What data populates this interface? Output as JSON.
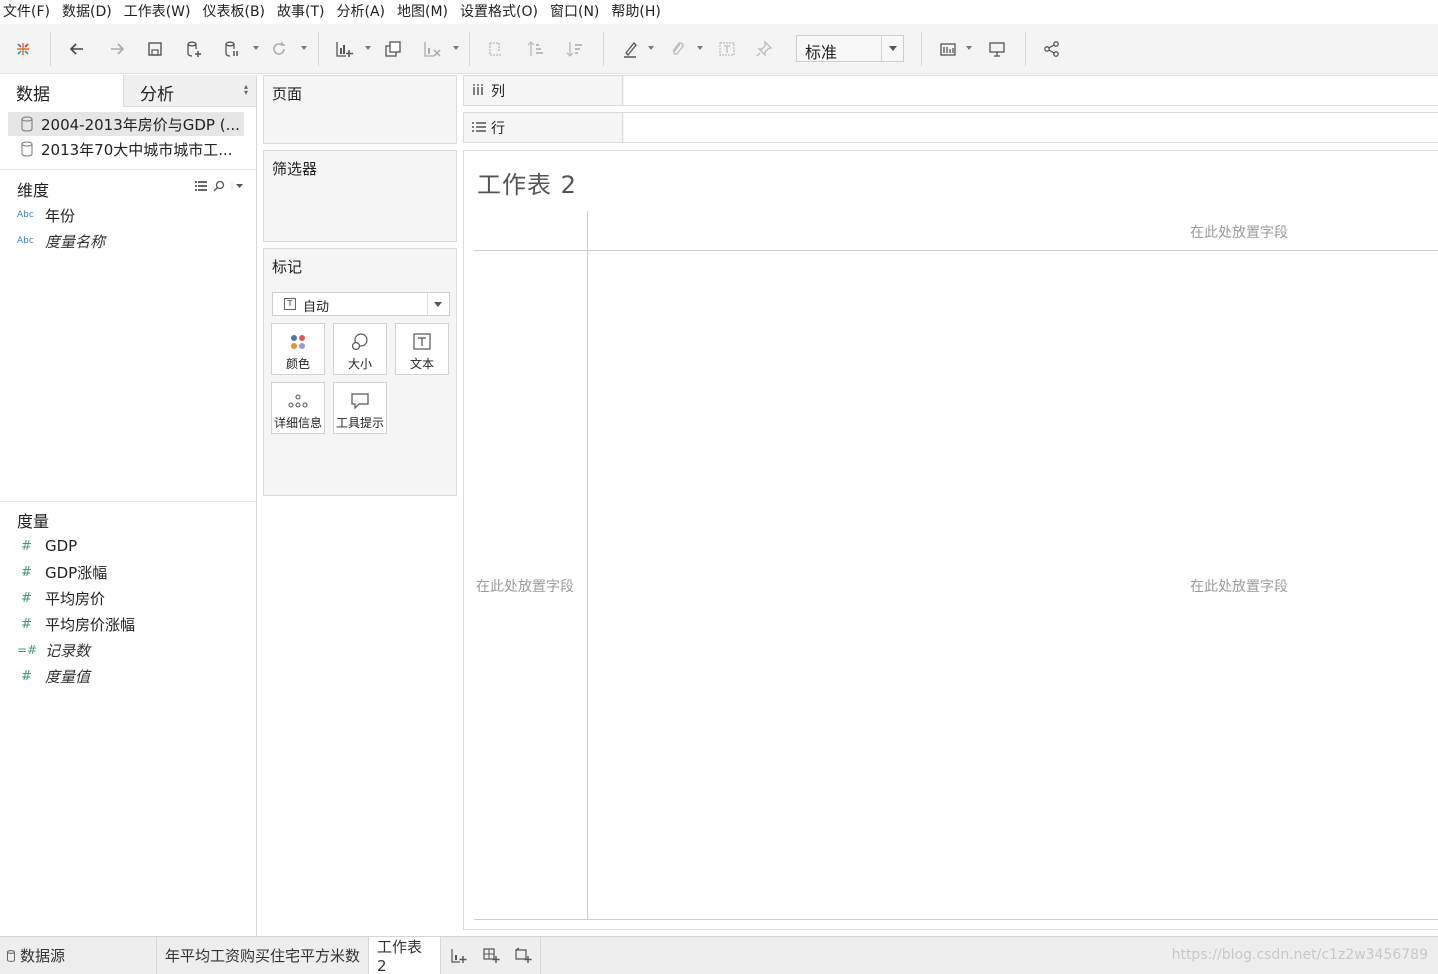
{
  "menu": [
    "文件(F)",
    "数据(D)",
    "工作表(W)",
    "仪表板(B)",
    "故事(T)",
    "分析(A)",
    "地图(M)",
    "设置格式(O)",
    "窗口(N)",
    "帮助(H)"
  ],
  "toolbar": {
    "fit_value": "标准"
  },
  "data_pane": {
    "tab_data": "数据",
    "tab_analysis": "分析",
    "datasources": [
      "2004-2013年房价与GDP (...",
      "2013年70大中城市城市工..."
    ],
    "dimensions_title": "维度",
    "dimensions": [
      {
        "type": "Abc",
        "name": "年份",
        "italic": false
      },
      {
        "type": "Abc",
        "name": "度量名称",
        "italic": true
      }
    ],
    "measures_title": "度量",
    "measures": [
      {
        "type": "#",
        "name": "GDP",
        "italic": false
      },
      {
        "type": "#",
        "name": "GDP涨幅",
        "italic": false
      },
      {
        "type": "#",
        "name": "平均房价",
        "italic": false
      },
      {
        "type": "#",
        "name": "平均房价涨幅",
        "italic": false
      },
      {
        "type": "=#",
        "name": "记录数",
        "italic": true
      },
      {
        "type": "#",
        "name": "度量值",
        "italic": true
      }
    ]
  },
  "cards": {
    "pages": "页面",
    "filters": "筛选器",
    "marks": "标记",
    "marks_type": "自动",
    "marks_buttons": [
      "颜色",
      "大小",
      "文本",
      "详细信息",
      "工具提示"
    ]
  },
  "shelves": {
    "columns": "列",
    "rows": "行"
  },
  "view": {
    "title": "工作表 2",
    "drop_hint": "在此处放置字段"
  },
  "bottom_tabs": {
    "datasource": "数据源",
    "sheets": [
      "年平均工资购买住宅平方米数",
      "工作表 2"
    ],
    "watermark": "https://blog.csdn.net/c1z2w3456789"
  }
}
